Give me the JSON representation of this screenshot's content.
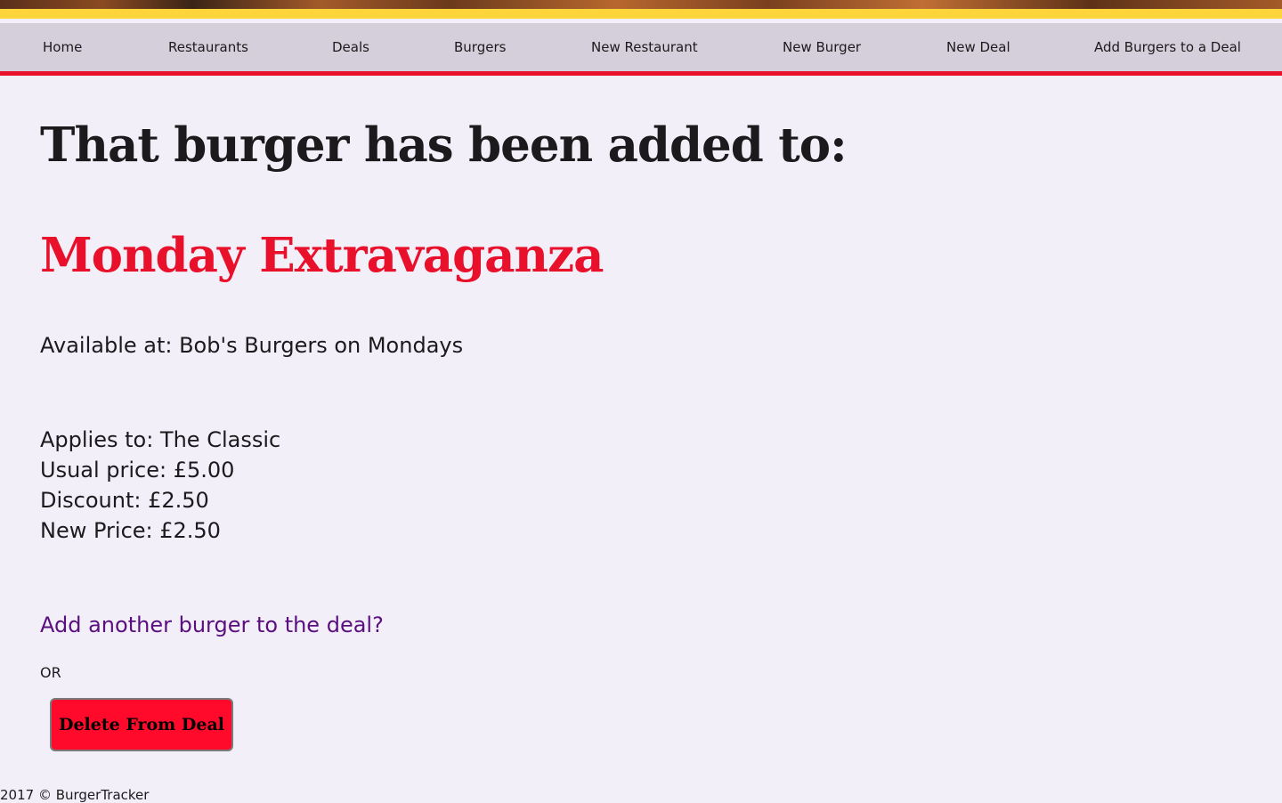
{
  "nav": {
    "items": [
      {
        "label": "Home"
      },
      {
        "label": "Restaurants"
      },
      {
        "label": "Deals"
      },
      {
        "label": "Burgers"
      },
      {
        "label": "New Restaurant"
      },
      {
        "label": "New Burger"
      },
      {
        "label": "New Deal"
      },
      {
        "label": "Add Burgers to a Deal"
      }
    ]
  },
  "main": {
    "title": "That burger has been added to:",
    "deal_name": "Monday Extravaganza",
    "available_at": "Available at: Bob's Burgers on Mondays",
    "applies_to": "Applies to: The Classic",
    "usual_price": "Usual price: £5.00",
    "discount": "Discount: £2.50",
    "new_price": "New Price: £2.50",
    "add_another_link": "Add another burger to the deal?",
    "or_text": "OR",
    "delete_button": "Delete From Deal"
  },
  "footer": {
    "text": "2017 © BurgerTracker"
  },
  "colors": {
    "nav_background": "#d5cfdb",
    "accent_red": "#e8102a",
    "banner_yellow": "#fdd43a",
    "link_purple": "#5a0f7f",
    "page_background": "#f2eff9"
  }
}
